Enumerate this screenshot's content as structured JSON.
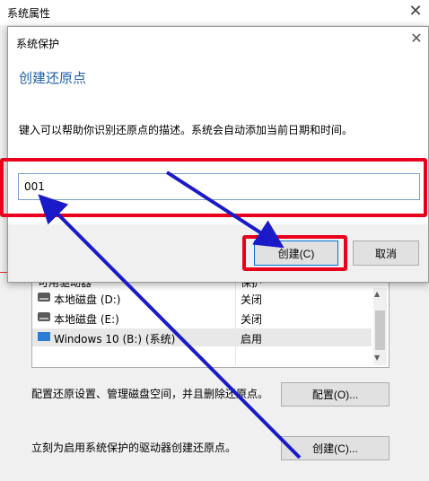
{
  "background_window": {
    "title": "系统属性",
    "list_header": {
      "col1": "可用驱动器",
      "col2": "保护"
    },
    "drives": [
      {
        "name": "本地磁盘 (D:)",
        "status": "关闭",
        "icon": "drive-icon"
      },
      {
        "name": "本地磁盘 (E:)",
        "status": "关闭",
        "icon": "drive-icon"
      },
      {
        "name": "Windows 10 (B:) (系统)",
        "status": "启用",
        "icon": "windows-drive-icon"
      }
    ],
    "config_description": "配置还原设置、管理磁盘空间，并且删除还原点。",
    "config_button": "配置(O)...",
    "create_description": "立刻为启用系统保护的驱动器创建还原点。",
    "create_button": "创建(C)..."
  },
  "dialog": {
    "title": "系统保护",
    "heading": "创建还原点",
    "description": "键入可以帮助你识别还原点的描述。系统会自动添加当前日期和时间。",
    "input_value": "001",
    "create_button": "创建(C)",
    "cancel_button": "取消"
  },
  "colors": {
    "heading": "#1f5fa8",
    "annotation_box": "#e8001c",
    "arrow": "#1a1ac8",
    "button_focus_border": "#0078d7"
  }
}
